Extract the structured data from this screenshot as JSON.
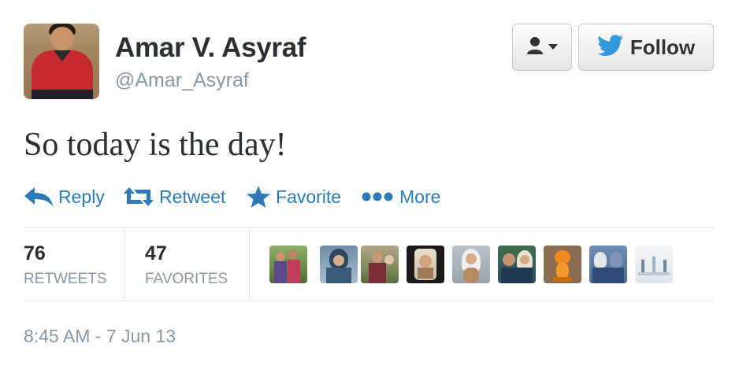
{
  "user": {
    "name": "Amar V. Asyraf",
    "handle": "@Amar_Asyraf"
  },
  "buttons": {
    "follow_label": "Follow"
  },
  "tweet": {
    "text": "So today is the day!"
  },
  "actions": [
    {
      "label": "Reply",
      "icon": "reply-icon"
    },
    {
      "label": "Retweet",
      "icon": "retweet-icon"
    },
    {
      "label": "Favorite",
      "icon": "star-icon"
    },
    {
      "label": "More",
      "icon": "more-dots-icon"
    }
  ],
  "stats": {
    "retweets_count": "76",
    "retweets_label": "RETWEETS",
    "favorites_count": "47",
    "favorites_label": "FAVORITES"
  },
  "favoriters": [
    {
      "icon": "user-avatar-1"
    },
    {
      "icon": "user-avatar-2"
    },
    {
      "icon": "user-avatar-3"
    },
    {
      "icon": "user-avatar-4"
    },
    {
      "icon": "user-avatar-5"
    },
    {
      "icon": "user-avatar-6"
    },
    {
      "icon": "user-avatar-7"
    },
    {
      "icon": "user-avatar-8"
    },
    {
      "icon": "user-avatar-9"
    }
  ],
  "timestamp": "8:45 AM - 7 Jun 13",
  "colors": {
    "link_blue": "#2b7bb9",
    "twitter_bird": "#3399dd",
    "muted_gray": "#8899a6",
    "text_dark": "#292f33"
  }
}
